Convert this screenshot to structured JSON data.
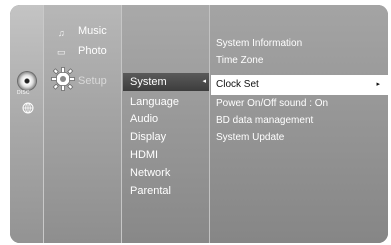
{
  "nav": {
    "music": "Music",
    "photo": "Photo",
    "setup": "Setup",
    "icons": {
      "music": "music-note-icon",
      "photo": "photo-icon",
      "setup": "gear-icon",
      "disc": "disc-icon",
      "network": "globe-icon"
    },
    "disc_label": "DISC"
  },
  "setup_menu": {
    "items": [
      "System",
      "Language",
      "Audio",
      "Display",
      "HDMI",
      "Network",
      "Parental"
    ],
    "selected": "System",
    "selected_arrow": "◂"
  },
  "system_menu": {
    "items": [
      "System Information",
      "Time Zone",
      "Clock Set",
      "Power On/Off sound   :  On",
      "BD data management",
      "System Update"
    ],
    "selected": "Clock Set",
    "selected_arrow": "▸"
  },
  "colors": {
    "panel_gray": "#a6a6a6",
    "selected_dark": "#3d3d3d",
    "selected_light": "#ffffff",
    "text": "#ffffff"
  }
}
